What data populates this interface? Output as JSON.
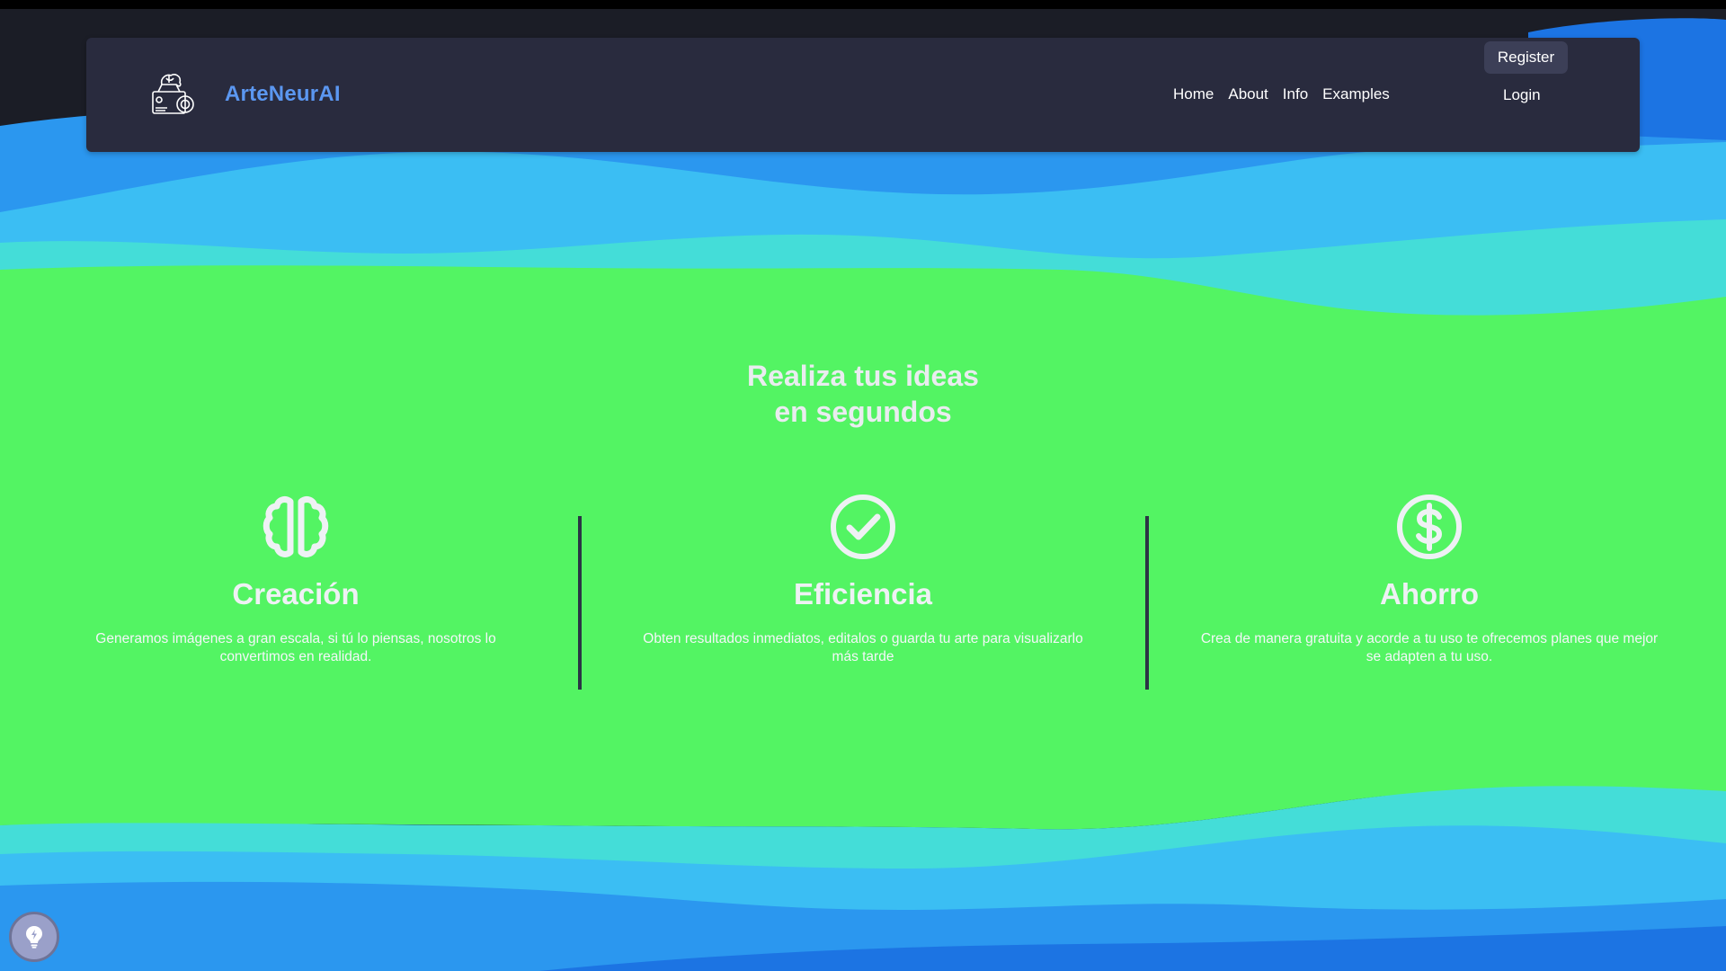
{
  "colors": {
    "page_bg": "#1b1d26",
    "wave_dark_blue": "#1c74e3",
    "wave_blue": "#2b97ef",
    "wave_sky": "#3bbef3",
    "wave_teal": "#44ddd8",
    "main_green": "#53f463",
    "navbar_bg": "#292b3e",
    "brand": "#5b97f1"
  },
  "navbar": {
    "logo_icon": "camera-robot-icon",
    "brand_name": "ArteNeurAI",
    "links": [
      "Home",
      "About",
      "Info",
      "Examples"
    ],
    "login_label": "Login",
    "register_label": "Register"
  },
  "hero": {
    "title_line1": "Realiza tus ideas",
    "title_line2": "en segundos"
  },
  "features": [
    {
      "icon": "brain-icon",
      "title": "Creación",
      "description": "Generamos imágenes a gran escala, si tú lo piensas, nosotros lo convertimos en realidad."
    },
    {
      "icon": "check-circle-icon",
      "title": "Eficiencia",
      "description": "Obten resultados inmediatos, editalos o guarda tu arte para visualizarlo más tarde"
    },
    {
      "icon": "dollar-circle-icon",
      "title": "Ahorro",
      "description": "Crea de manera gratuita y acorde a tu uso te ofrecemos planes que mejor se adapten a tu uso."
    }
  ],
  "floating_button": {
    "icon": "lightbulb-icon"
  }
}
